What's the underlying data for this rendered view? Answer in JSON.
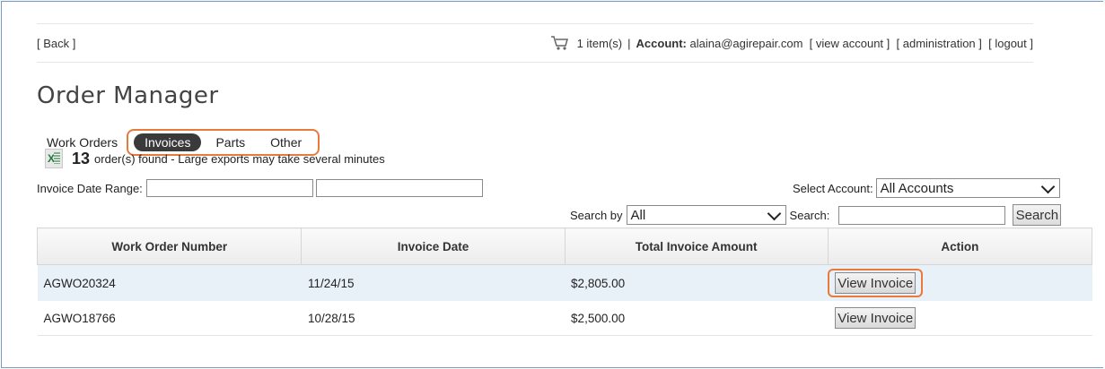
{
  "header": {
    "back_label": "[ Back ]",
    "cart_items": "1 item(s)",
    "divider": "|",
    "account_label": "Account:",
    "account_email": "alaina@agirepair.com",
    "view_account": "[ view account ]",
    "administration": "[ administration ]",
    "logout": "[ logout ]"
  },
  "page_title": "Order Manager",
  "tabs": {
    "work_orders": "Work Orders",
    "invoices": "Invoices",
    "parts": "Parts",
    "other": "Other",
    "active": "Invoices"
  },
  "summary": {
    "count": "13",
    "text": "order(s) found - Large exports may take several minutes"
  },
  "filters": {
    "date_range_label": "Invoice Date Range:",
    "date_from": "",
    "date_to": "",
    "select_account_label": "Select Account:",
    "select_account_value": "All Accounts",
    "search_by_label": "Search by",
    "search_by_value": "All",
    "search_label": "Search:",
    "search_value": "",
    "search_button": "Search"
  },
  "table": {
    "columns": [
      "Work Order Number",
      "Invoice Date",
      "Total Invoice Amount",
      "Action"
    ],
    "rows": [
      {
        "work_order": "AGWO20324",
        "date": "11/24/15",
        "amount": "$2,805.00",
        "action": "View Invoice"
      },
      {
        "work_order": "AGWO18766",
        "date": "10/28/15",
        "amount": "$2,500.00",
        "action": "View Invoice"
      }
    ]
  },
  "colors": {
    "highlight": "#e87a3c",
    "active_tab": "#3a3a3a",
    "row_highlight": "#e8f0f8",
    "frame_border": "#7a9bc3"
  }
}
